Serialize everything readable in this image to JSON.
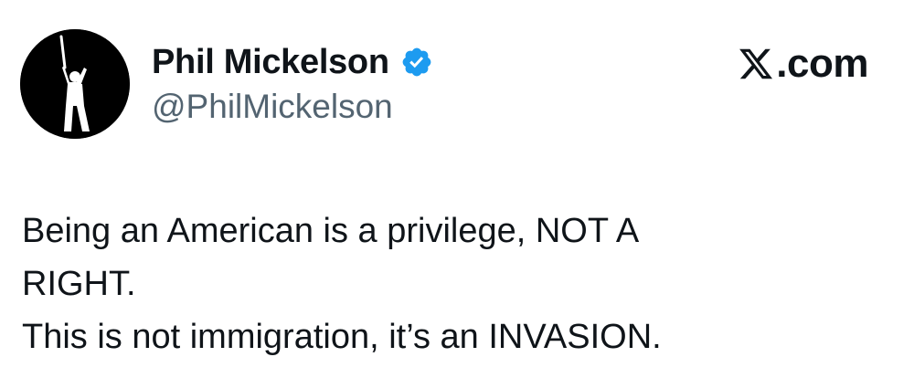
{
  "profile": {
    "display_name": "Phil Mickelson",
    "handle": "@PhilMickelson",
    "verified_icon": "verified-badge-icon",
    "verified_color": "#1d9bf0",
    "avatar_icon": "golfer-silhouette-icon"
  },
  "source": {
    "logo_icon": "x-logo-icon",
    "label": ".com"
  },
  "tweet": {
    "lines": [
      "Being an American is a privilege, NOT A",
      "RIGHT.",
      "This is not immigration, it’s an INVASION."
    ]
  },
  "colors": {
    "text_primary": "#0f1419",
    "text_secondary": "#536471",
    "background": "#ffffff"
  }
}
